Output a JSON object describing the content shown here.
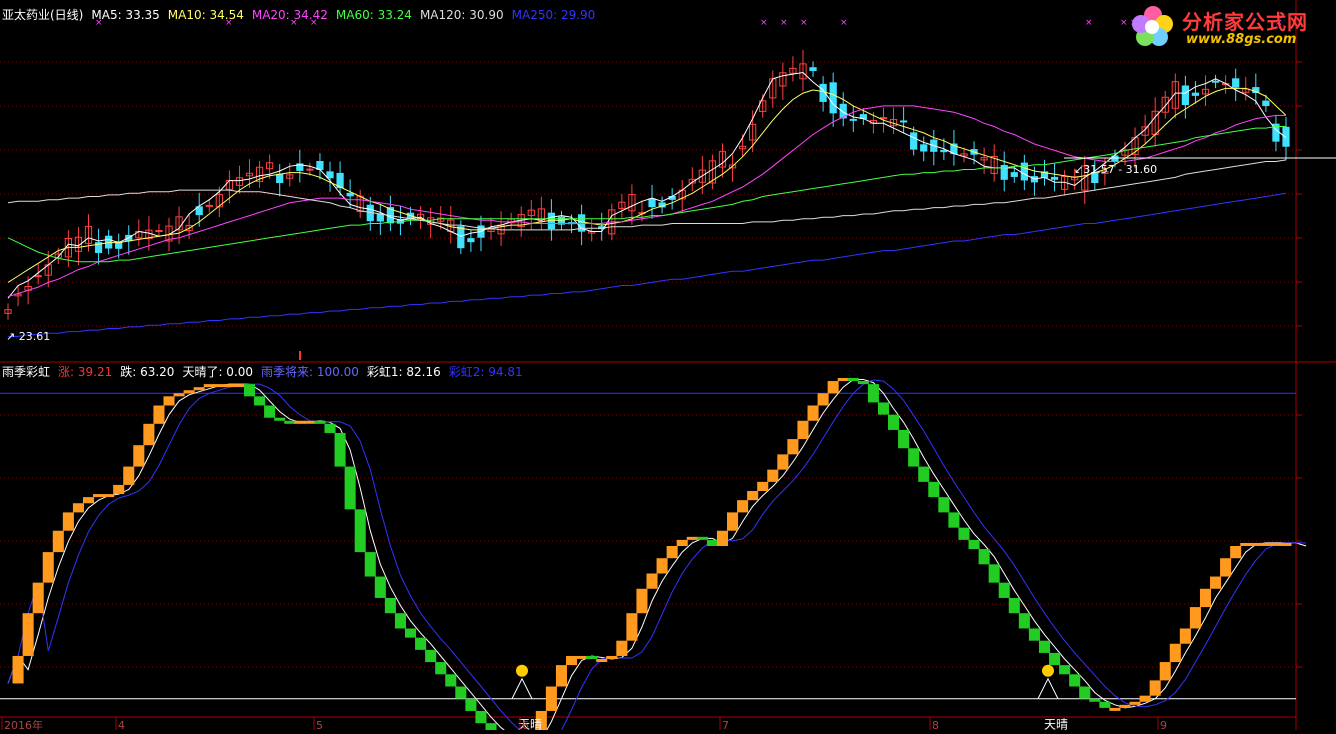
{
  "top_legend": {
    "title": "亚太药业(日线)",
    "items": [
      {
        "label": "MA5: 33.35",
        "color": "#ffffff"
      },
      {
        "label": "MA10: 34.54",
        "color": "#ffff66"
      },
      {
        "label": "MA20: 34.42",
        "color": "#ff44ff"
      },
      {
        "label": "MA60: 33.24",
        "color": "#44ff44"
      },
      {
        "label": "MA120: 30.90",
        "color": "#dddddd"
      },
      {
        "label": "MA250: 29.90",
        "color": "#3333ff"
      }
    ]
  },
  "bottom_legend": {
    "title": "雨季彩虹",
    "items": [
      {
        "label": "涨: 39.21",
        "color": "#ff3333"
      },
      {
        "label": "跌: 63.20",
        "color": "#ffffff"
      },
      {
        "label": "天晴了: 0.00",
        "color": "#ffffff"
      },
      {
        "label": "雨季将来: 100.00",
        "color": "#6666ff"
      },
      {
        "label": "彩虹1: 82.16",
        "color": "#ffffff"
      },
      {
        "label": "彩虹2: 94.81",
        "color": "#3333ff"
      }
    ]
  },
  "logo": {
    "title": "分析家公式网",
    "url": "www.88gs.com"
  },
  "annotations": {
    "low": "23.61",
    "range": "31.57 - 31.60",
    "sunny": "天晴"
  },
  "x_axis": {
    "labels": [
      "2016年",
      "4",
      "5",
      "6",
      "7",
      "8",
      "9"
    ]
  },
  "colors": {
    "up": "#ff4040",
    "down": "#40e0ff",
    "rise": "#ff9a1f",
    "fall": "#22cc22",
    "grid": "#8b0000"
  },
  "chart_data": [
    {
      "type": "candlestick",
      "title": "亚太药业(日线)",
      "ylim": [
        22,
        42
      ],
      "x_count": 128,
      "series": [
        {
          "name": "MA5",
          "values": [
            24.5,
            25.3,
            25.6,
            26.1,
            26.6,
            27.1,
            27.9,
            27.8,
            28.3,
            28.1,
            28.2,
            28.0,
            28.3,
            28.7,
            28.6,
            28.4,
            28.5,
            28.9,
            29.8,
            30.3,
            30.7,
            31.2,
            31.9,
            31.9,
            32.0,
            32.2,
            32.3,
            32.5,
            32.8,
            32.9,
            32.8,
            32.6,
            31.9,
            31.1,
            30.4,
            30.2,
            30.1,
            29.9,
            29.6,
            29.4,
            29.5,
            29.6,
            29.2,
            29.0,
            28.7,
            28.4,
            28.6,
            28.7,
            29.0,
            29.1,
            29.3,
            29.4,
            29.5,
            29.4,
            29.6,
            29.7,
            29.6,
            28.9,
            28.7,
            28.7,
            29.7,
            30.0,
            30.3,
            30.6,
            30.8,
            30.6,
            30.9,
            31.3,
            31.8,
            32.2,
            32.6,
            33.0,
            33.6,
            34.6,
            35.8,
            37.1,
            38.3,
            38.5,
            38.6,
            38.7,
            38.1,
            37.6,
            36.7,
            36.2,
            35.9,
            35.8,
            35.5,
            35.5,
            35.2,
            34.9,
            34.6,
            34.3,
            34.1,
            33.9,
            33.6,
            33.4,
            33.2,
            32.8,
            32.7,
            32.7,
            32.7,
            32.3,
            32.0,
            32.1,
            31.8,
            31.8,
            31.6,
            32.1,
            32.5,
            33.0,
            33.5,
            34.0,
            34.6,
            35.1,
            35.9,
            36.6,
            37.4,
            37.4,
            37.8,
            38.0,
            38.3,
            38.0,
            37.6,
            37.3,
            36.9,
            35.9,
            35.1,
            34.6
          ]
        },
        {
          "name": "MA10",
          "values": [
            25.5,
            25.9,
            26.3,
            26.7,
            27.1,
            27.5,
            27.7,
            27.7,
            27.8,
            27.9,
            28.0,
            28.0,
            28.1,
            28.2,
            28.3,
            28.4,
            28.5,
            28.6,
            28.9,
            29.3,
            29.8,
            30.3,
            30.8,
            31.3,
            31.7,
            32.0,
            32.2,
            32.3,
            32.4,
            32.4,
            32.3,
            32.1,
            31.8,
            31.5,
            31.2,
            30.9,
            30.6,
            30.4,
            30.1,
            29.9,
            29.7,
            29.5,
            29.3,
            29.2,
            29.0,
            28.9,
            28.8,
            28.8,
            28.9,
            29.0,
            29.1,
            29.1,
            29.2,
            29.3,
            29.4,
            29.4,
            29.5,
            29.3,
            29.2,
            29.1,
            29.2,
            29.3,
            29.5,
            29.8,
            30.1,
            30.3,
            30.5,
            30.8,
            31.1,
            31.5,
            31.9,
            32.3,
            32.8,
            33.4,
            34.1,
            34.9,
            35.7,
            36.4,
            37.0,
            37.4,
            37.6,
            37.5,
            37.3,
            37.0,
            36.6,
            36.3,
            36.0,
            35.7,
            35.5,
            35.3,
            35.1,
            34.9,
            34.6,
            34.4,
            34.1,
            33.9,
            33.7,
            33.5,
            33.3,
            33.1,
            32.9,
            32.7,
            32.5,
            32.4,
            32.3,
            32.2,
            32.1,
            32.2,
            32.4,
            32.6,
            32.9,
            33.3,
            33.7,
            34.2,
            34.8,
            35.4,
            36.0,
            36.4,
            36.8,
            37.2,
            37.5,
            37.7,
            37.7,
            37.7,
            37.5,
            37.2,
            36.6,
            36.0
          ]
        },
        {
          "name": "MA20",
          "values": [
            24.6,
            24.8,
            25.0,
            25.2,
            25.5,
            25.7,
            26.0,
            26.3,
            26.5,
            26.8,
            27.0,
            27.2,
            27.4,
            27.6,
            27.8,
            28.0,
            28.2,
            28.3,
            28.5,
            28.7,
            28.9,
            29.1,
            29.3,
            29.5,
            29.7,
            29.9,
            30.1,
            30.3,
            30.5,
            30.6,
            30.7,
            30.8,
            30.8,
            30.8,
            30.7,
            30.7,
            30.6,
            30.5,
            30.4,
            30.3,
            30.1,
            30.0,
            29.9,
            29.8,
            29.7,
            29.6,
            29.5,
            29.4,
            29.4,
            29.3,
            29.3,
            29.3,
            29.2,
            29.2,
            29.2,
            29.2,
            29.2,
            29.2,
            29.2,
            29.2,
            29.3,
            29.3,
            29.4,
            29.5,
            29.6,
            29.7,
            29.8,
            30.0,
            30.2,
            30.4,
            30.6,
            30.9,
            31.2,
            31.5,
            31.9,
            32.3,
            32.8,
            33.3,
            33.8,
            34.3,
            34.8,
            35.2,
            35.6,
            35.9,
            36.2,
            36.4,
            36.5,
            36.6,
            36.6,
            36.6,
            36.6,
            36.5,
            36.4,
            36.3,
            36.2,
            36.0,
            35.8,
            35.5,
            35.3,
            35.0,
            34.8,
            34.5,
            34.2,
            34.0,
            33.8,
            33.6,
            33.4,
            33.3,
            33.2,
            33.1,
            33.1,
            33.1,
            33.2,
            33.3,
            33.5,
            33.7,
            33.9,
            34.1,
            34.4,
            34.6,
            34.9,
            35.1,
            35.4,
            35.6,
            35.8,
            35.9,
            36.0,
            36.0
          ]
        },
        {
          "name": "MA60",
          "values": [
            28.3,
            28.0,
            27.7,
            27.4,
            27.2,
            27.0,
            26.9,
            26.8,
            26.8,
            26.8,
            26.8,
            26.9,
            26.9,
            27.0,
            27.1,
            27.2,
            27.3,
            27.4,
            27.5,
            27.6,
            27.7,
            27.8,
            27.9,
            28.0,
            28.1,
            28.2,
            28.3,
            28.4,
            28.5,
            28.6,
            28.7,
            28.8,
            28.9,
            29.0,
            29.1,
            29.1,
            29.2,
            29.2,
            29.3,
            29.3,
            29.4,
            29.4,
            29.4,
            29.5,
            29.5,
            29.5,
            29.5,
            29.5,
            29.5,
            29.5,
            29.5,
            29.5,
            29.5,
            29.5,
            29.5,
            29.5,
            29.5,
            29.5,
            29.5,
            29.5,
            29.5,
            29.5,
            29.6,
            29.6,
            29.7,
            29.7,
            29.8,
            29.9,
            30.0,
            30.1,
            30.2,
            30.3,
            30.4,
            30.6,
            30.7,
            30.9,
            31.0,
            31.1,
            31.2,
            31.3,
            31.4,
            31.5,
            31.6,
            31.7,
            31.8,
            31.9,
            32.0,
            32.1,
            32.2,
            32.3,
            32.3,
            32.4,
            32.4,
            32.5,
            32.5,
            32.6,
            32.6,
            32.7,
            32.7,
            32.7,
            32.8,
            32.8,
            32.9,
            32.9,
            33.0,
            33.1,
            33.2,
            33.3,
            33.4,
            33.5,
            33.6,
            33.8,
            33.9,
            34.0,
            34.1,
            34.2,
            34.3,
            34.4,
            34.6,
            34.7,
            34.8,
            34.9,
            35.0,
            35.1,
            35.2,
            35.2,
            35.3,
            35.3
          ]
        },
        {
          "name": "MA120",
          "values": [
            30.5,
            30.6,
            30.6,
            30.6,
            30.7,
            30.7,
            30.8,
            30.8,
            30.9,
            30.9,
            31.0,
            31.0,
            31.1,
            31.1,
            31.2,
            31.2,
            31.2,
            31.3,
            31.3,
            31.3,
            31.3,
            31.3,
            31.3,
            31.2,
            31.2,
            31.2,
            31.1,
            31.0,
            30.9,
            30.8,
            30.7,
            30.6,
            30.5,
            30.3,
            30.2,
            30.0,
            29.9,
            29.8,
            29.7,
            29.6,
            29.5,
            29.4,
            29.3,
            29.2,
            29.1,
            29.1,
            29.0,
            28.9,
            28.9,
            28.8,
            28.8,
            28.8,
            28.8,
            28.8,
            28.8,
            28.8,
            28.8,
            28.9,
            28.9,
            28.9,
            29.0,
            29.0,
            29.0,
            29.1,
            29.1,
            29.1,
            29.2,
            29.2,
            29.2,
            29.2,
            29.2,
            29.2,
            29.2,
            29.2,
            29.3,
            29.3,
            29.3,
            29.4,
            29.4,
            29.5,
            29.5,
            29.6,
            29.6,
            29.7,
            29.7,
            29.8,
            29.8,
            29.9,
            30.0,
            30.0,
            30.1,
            30.1,
            30.2,
            30.2,
            30.3,
            30.3,
            30.4,
            30.4,
            30.5,
            30.5,
            30.6,
            30.7,
            30.8,
            30.8,
            30.9,
            31.0,
            31.1,
            31.2,
            31.3,
            31.4,
            31.5,
            31.6,
            31.7,
            31.8,
            31.9,
            32.0,
            32.1,
            32.3,
            32.4,
            32.5,
            32.6,
            32.7,
            32.8,
            32.9,
            33.0,
            33.1,
            33.1,
            33.2
          ]
        },
        {
          "name": "MA250",
          "values": [
            22.1,
            22.1,
            22.2,
            22.2,
            22.3,
            22.3,
            22.4,
            22.4,
            22.5,
            22.5,
            22.6,
            22.6,
            22.7,
            22.7,
            22.8,
            22.8,
            22.9,
            22.9,
            23.0,
            23.0,
            23.1,
            23.1,
            23.2,
            23.2,
            23.3,
            23.3,
            23.4,
            23.4,
            23.5,
            23.5,
            23.6,
            23.6,
            23.7,
            23.7,
            23.8,
            23.8,
            23.9,
            23.9,
            24.0,
            24.0,
            24.1,
            24.1,
            24.2,
            24.2,
            24.3,
            24.3,
            24.4,
            24.4,
            24.5,
            24.5,
            24.6,
            24.6,
            24.7,
            24.7,
            24.8,
            24.8,
            24.9,
            24.9,
            25.0,
            25.1,
            25.2,
            25.3,
            25.3,
            25.4,
            25.5,
            25.6,
            25.7,
            25.7,
            25.8,
            25.9,
            26.0,
            26.1,
            26.2,
            26.2,
            26.3,
            26.4,
            26.5,
            26.6,
            26.7,
            26.8,
            26.9,
            26.9,
            27.0,
            27.1,
            27.2,
            27.3,
            27.4,
            27.5,
            27.5,
            27.6,
            27.7,
            27.8,
            27.9,
            28.0,
            28.1,
            28.1,
            28.2,
            28.3,
            28.4,
            28.5,
            28.5,
            28.6,
            28.7,
            28.8,
            28.9,
            29.0,
            29.1,
            29.2,
            29.2,
            29.3,
            29.4,
            29.5,
            29.6,
            29.7,
            29.8,
            29.9,
            30.0,
            30.1,
            30.2,
            30.3,
            30.4,
            30.5,
            30.6,
            30.7,
            30.8,
            30.9,
            31.0,
            31.1
          ]
        }
      ]
    },
    {
      "type": "line",
      "title": "雨季彩虹",
      "ylim": [
        -5,
        105
      ],
      "x_count": 128,
      "hlines": [
        {
          "value": 0,
          "name": "天晴了"
        },
        {
          "value": 100,
          "name": "雨季将来"
        }
      ],
      "series": [
        {
          "name": "main",
          "values": [
            5,
            14,
            28,
            38,
            48,
            55,
            61,
            64,
            66,
            67,
            67,
            70,
            76,
            83,
            90,
            96,
            99,
            100,
            101,
            102,
            103,
            103,
            103,
            103,
            99,
            96,
            92,
            91,
            90,
            91,
            91,
            90,
            87,
            76,
            62,
            48,
            40,
            33,
            28,
            23,
            20,
            16,
            12,
            8,
            4,
            0,
            -4,
            -8,
            -11,
            -13,
            -15,
            -16,
            -11,
            -4,
            4,
            11,
            14,
            14,
            13,
            13,
            14,
            19,
            28,
            36,
            41,
            46,
            50,
            52,
            53,
            52,
            50,
            55,
            61,
            65,
            68,
            71,
            75,
            80,
            85,
            91,
            96,
            100,
            104,
            105,
            104,
            103,
            97,
            93,
            88,
            82,
            76,
            71,
            66,
            61,
            56,
            52,
            49,
            44,
            38,
            33,
            28,
            23,
            19,
            15,
            11,
            8,
            4,
            0,
            -1,
            -3,
            -3,
            -2,
            -1,
            1,
            6,
            12,
            18,
            23,
            30,
            36,
            40,
            46,
            50,
            51,
            51,
            51,
            51,
            51,
            49,
            47
          ]
        }
      ]
    }
  ]
}
